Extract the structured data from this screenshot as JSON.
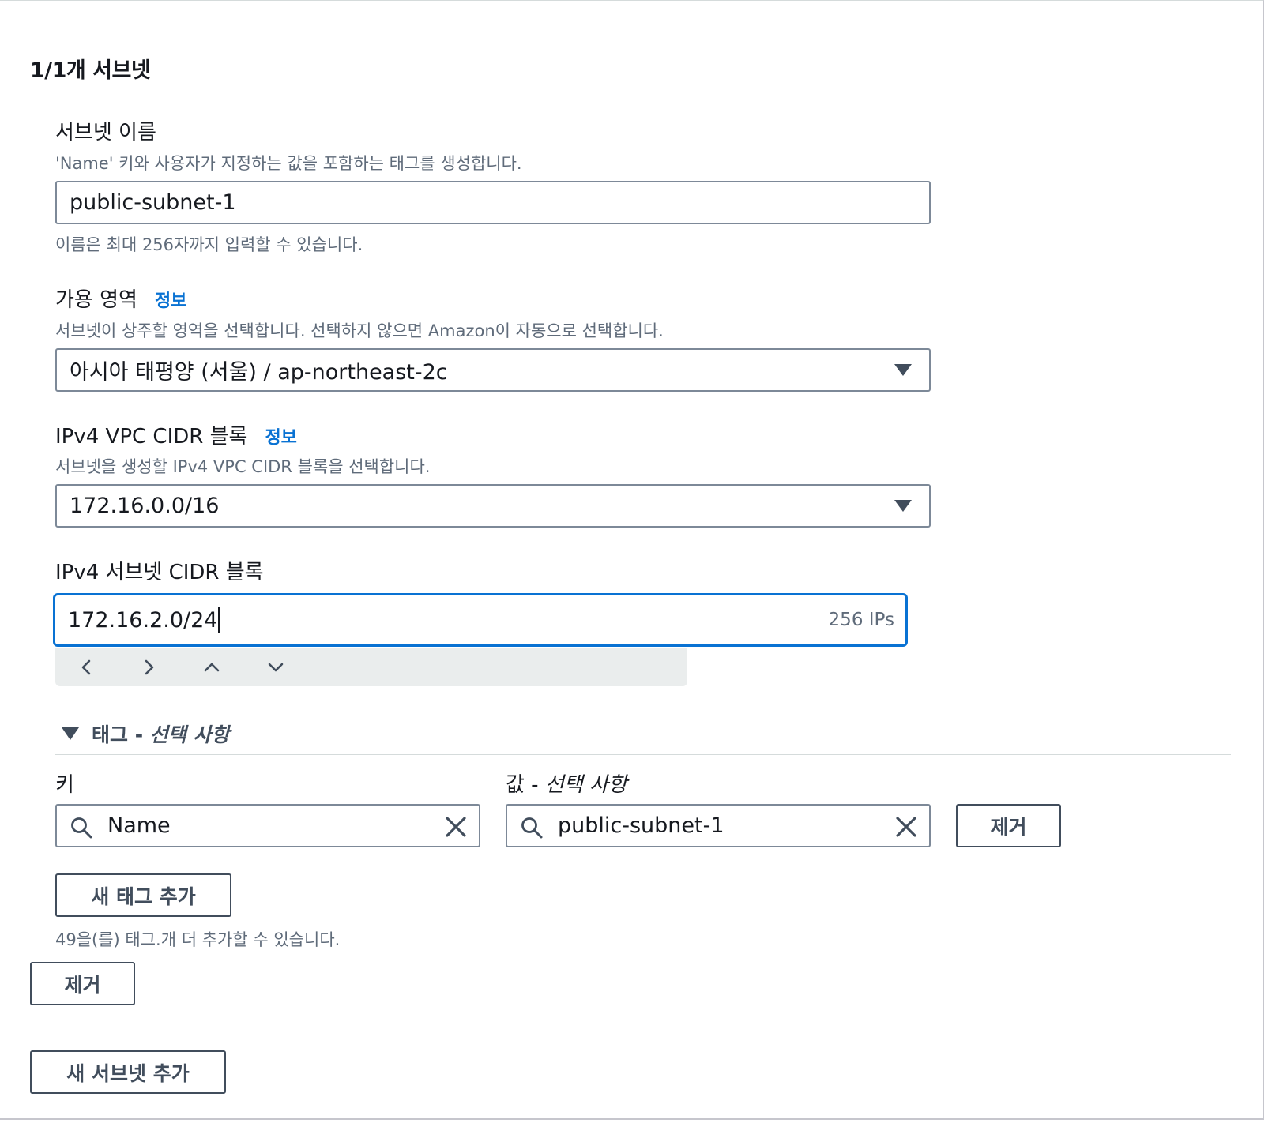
{
  "section": {
    "title": "1/1개 서브넷"
  },
  "subnet_name": {
    "label": "서브넷 이름",
    "description": "'Name' 키와 사용자가 지정하는 값을 포함하는 태그를 생성합니다.",
    "value": "public-subnet-1",
    "hint": "이름은 최대 256자까지 입력할 수 있습니다."
  },
  "availability_zone": {
    "label": "가용 영역",
    "info": "정보",
    "description": "서브넷이 상주할 영역을 선택합니다. 선택하지 않으면 Amazon이 자동으로 선택합니다.",
    "value": "아시아 태평양 (서울) / ap-northeast-2c"
  },
  "vpc_cidr": {
    "label": "IPv4 VPC CIDR 블록",
    "info": "정보",
    "description": "서브넷을 생성할 IPv4 VPC CIDR 블록을 선택합니다.",
    "value": "172.16.0.0/16"
  },
  "subnet_cidr": {
    "label": "IPv4 서브넷 CIDR 블록",
    "value": "172.16.2.0/24",
    "suffix": "256 IPs"
  },
  "tags": {
    "expander_label": "태그 - ",
    "expander_optional": "선택 사항",
    "key_label": "키",
    "value_label": "값 - ",
    "value_optional": "선택 사항",
    "key_value": "Name",
    "value_value": "public-subnet-1",
    "remove_label": "제거",
    "add_label": "새 태그 추가",
    "remaining_text": "49을(를) 태그.개 더 추가할 수 있습니다."
  },
  "actions": {
    "remove_subnet_label": "제거",
    "add_subnet_label": "새 서브넷 추가"
  },
  "colors": {
    "accent": "#0972d3",
    "text": "#16191f",
    "muted": "#5f6b7a",
    "border": "#7d8998"
  }
}
